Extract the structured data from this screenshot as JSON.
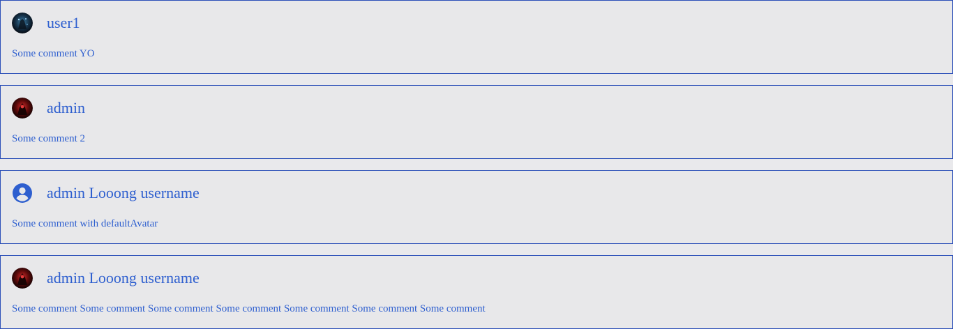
{
  "comments": [
    {
      "avatar": "dark-blue-avatar-image",
      "username": "user1",
      "text": "Some comment YO"
    },
    {
      "avatar": "dark-red-avatar-image",
      "username": "admin",
      "text": "Some comment 2"
    },
    {
      "avatar": "default-user-icon",
      "username": "admin Looong username",
      "text": "Some comment with defaultAvatar"
    },
    {
      "avatar": "dark-red-avatar-image",
      "username": "admin Looong username",
      "text": "Some comment Some comment Some comment Some comment Some comment Some comment Some comment"
    }
  ],
  "colors": {
    "accent": "#2e5fcf",
    "border": "#2b4fb8",
    "background": "#e9e9ec"
  }
}
